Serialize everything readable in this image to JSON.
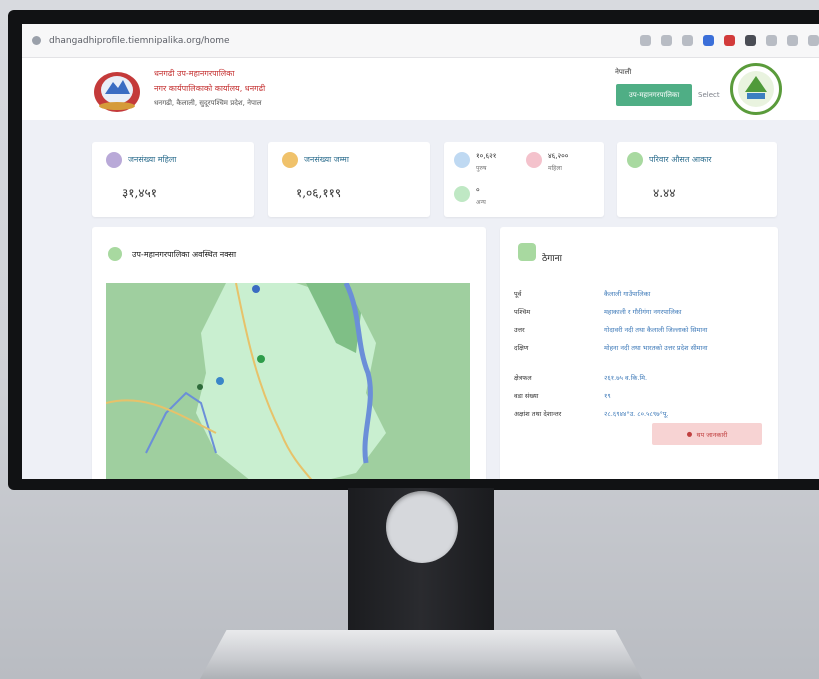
{
  "browser": {
    "url": "dhangadhiprofile.tiemnipalika.org/home"
  },
  "header": {
    "title_line1": "धनगढी उप-महानगरपालिका",
    "title_line2": "नगर कार्यपालिकाको कार्यालय, धनगढी",
    "title_line3": "धनगढी, कैलाली, सुदूरपश्चिम प्रदेश, नेपाल",
    "right_label": "नेपाली",
    "button_label": "उप-महानगरपालिका",
    "link_label": "Select"
  },
  "stats": [
    {
      "label": "जनसंख्या महिला",
      "value": "३१,४५१",
      "icon": "female-icon",
      "color": "#b9a9d8"
    },
    {
      "label": "जनसंख्या जम्मा",
      "value": "१,०६,११९",
      "icon": "people-icon",
      "color": "#f0c26b"
    },
    {
      "label": "परिवार औसत आकार",
      "value": "४.४४",
      "icon": "house-icon",
      "color": "#a8d9a0"
    }
  ],
  "mixed_card": {
    "items": [
      {
        "value": "१०,६२१",
        "label": "पुरुष",
        "icon": "male-icon",
        "color": "#bfd9f2"
      },
      {
        "value": "४६,२००",
        "label": "महिला",
        "icon": "woman-icon",
        "color": "#f4c2cc"
      },
      {
        "value": "०",
        "label": "अन्य",
        "icon": "other-icon",
        "color": "#bfe8c4"
      }
    ]
  },
  "map_panel": {
    "title": "उप-महानगरपालिका अवस्थित नक्सा",
    "icon": "globe-icon"
  },
  "contact_panel": {
    "title": "ठेगाना",
    "icon": "map-marker-icon",
    "rows": [
      {
        "label": "पूर्व",
        "value": "कैलाली गाउँपालिका"
      },
      {
        "label": "पश्चिम",
        "value": "महाकाली र गौरीगंगा नगरपालिका"
      },
      {
        "label": "उत्तर",
        "value": "गोदावरी नदी तथा कैलाली जिल्लाको सिमाना"
      },
      {
        "label": "दक्षिण",
        "value": "मोहना नदी तथा भारतको उत्तर प्रदेश सीमाना"
      },
      {
        "label": "क्षेत्रफल",
        "value": "२६१.७५ व.कि.मि."
      },
      {
        "label": "वडा संख्या",
        "value": "१९"
      },
      {
        "label": "अक्षांश तथा देशान्तर",
        "value": "२८.६९४४°उ. ८०.५८९७°पू."
      }
    ],
    "button_label": "थप जानकारी"
  },
  "colors": {
    "accent_green": "#4fae85",
    "title_red": "#c53333",
    "label_blue": "#2f6f8f"
  }
}
